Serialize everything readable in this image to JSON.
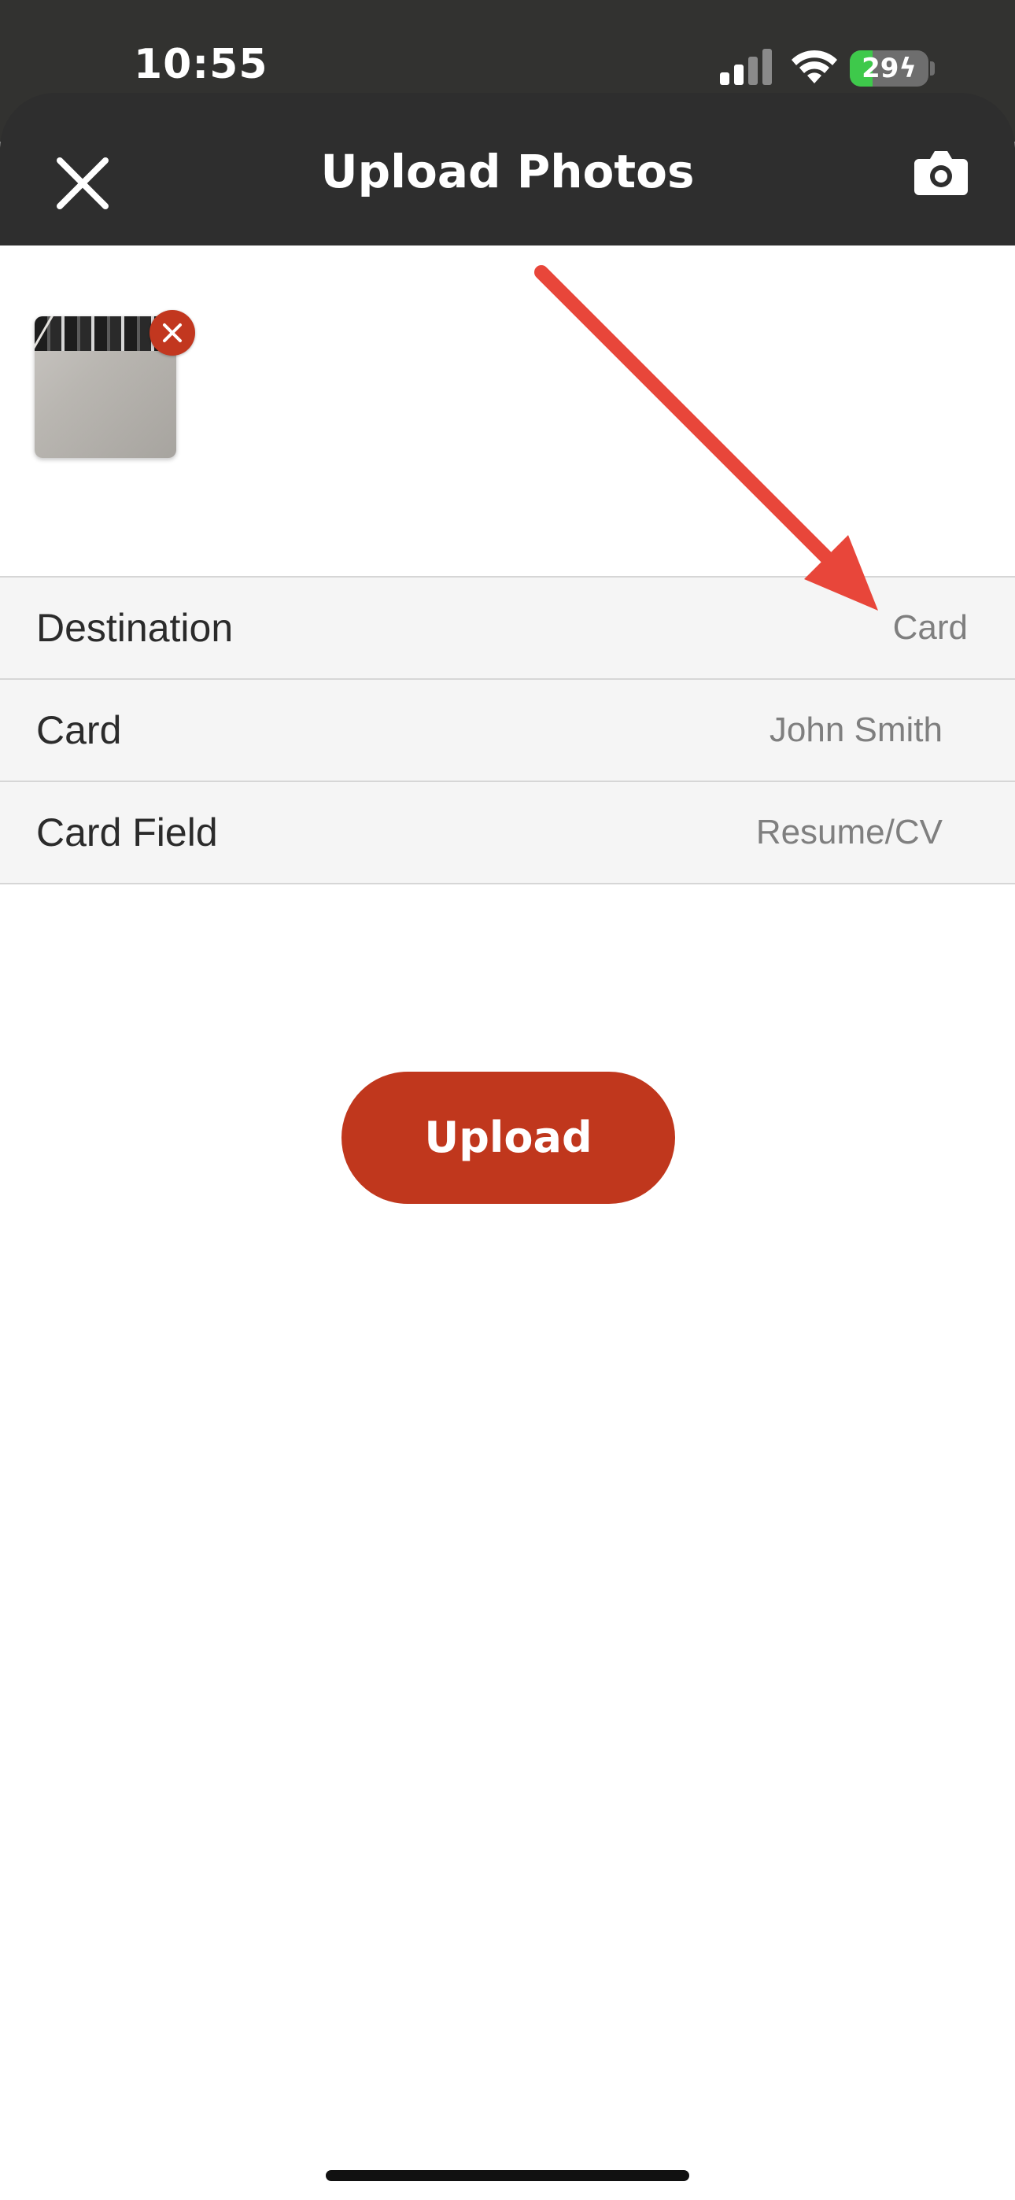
{
  "status_bar": {
    "time": "10:55",
    "battery_percent": "29",
    "battery_level": 0.29,
    "battery_charging": true
  },
  "header": {
    "title": "Upload Photos",
    "close_icon": "close-icon",
    "camera_icon": "camera-icon"
  },
  "photos": [
    {
      "remove_icon": "remove-icon"
    }
  ],
  "annotation": {
    "arrow_color": "#e8463a"
  },
  "rows": [
    {
      "label": "Destination",
      "value": "Card"
    },
    {
      "label": "Card",
      "value": "John Smith"
    },
    {
      "label": "Card Field",
      "value": "Resume/CV"
    }
  ],
  "upload_button": {
    "label": "Upload",
    "color": "#c0371d"
  },
  "colors": {
    "header_bg": "#2e2e2e",
    "row_bg": "#f5f5f5",
    "accent": "#c0371d"
  }
}
